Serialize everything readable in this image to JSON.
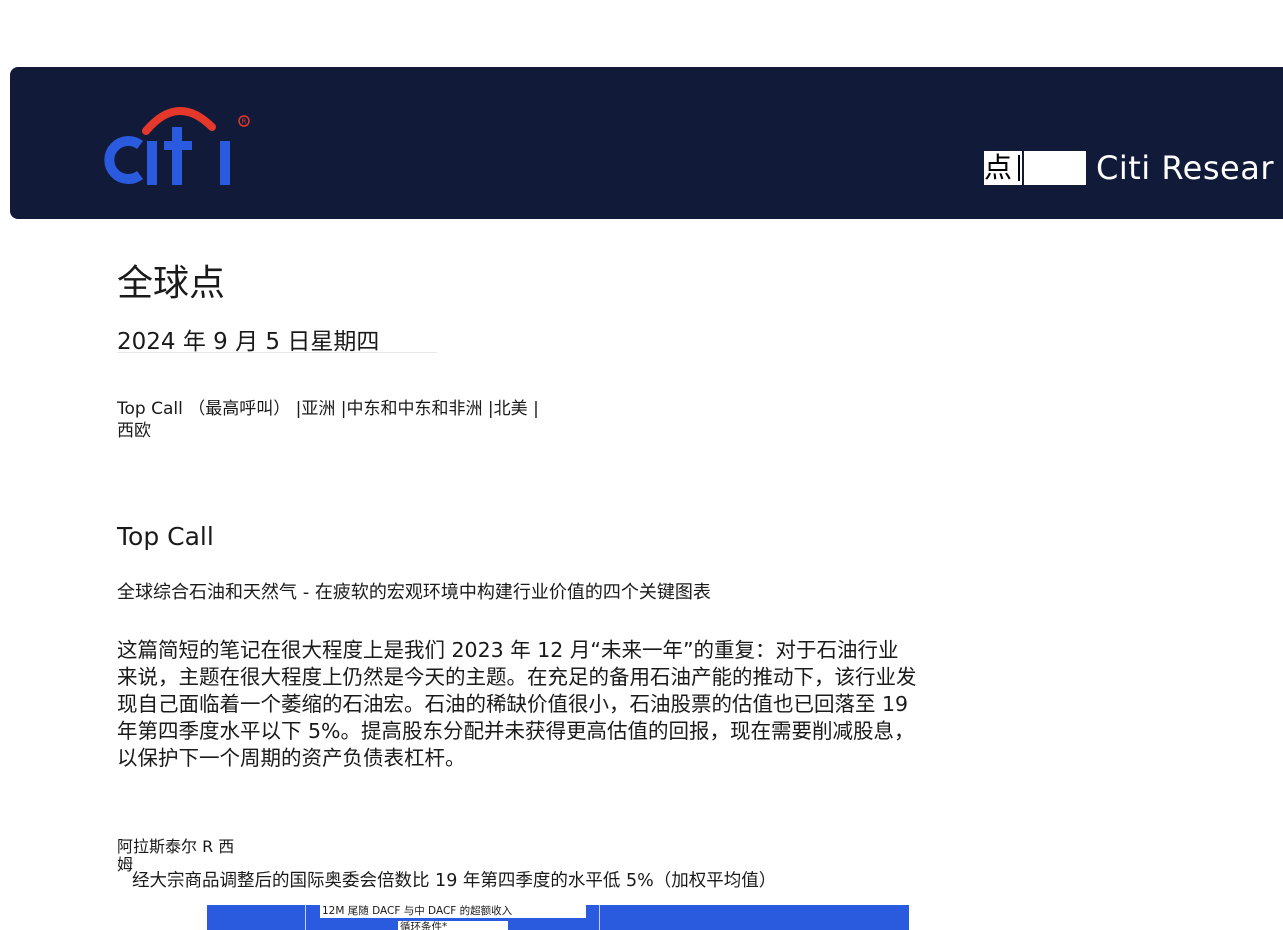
{
  "banner": {
    "logo_text": "citi",
    "right_char": "点",
    "brand_text": "Citi Resear"
  },
  "document": {
    "title": "全球点",
    "date": "2024 年 9 月 5 日星期四",
    "nav": {
      "top_call": "Top Call （最高呼叫）",
      "sep1": "|",
      "asia": "亚洲",
      "sep2": "|",
      "mea": "中东和中东和非洲",
      "sep3": "|",
      "na": "北美",
      "sep4": "|",
      "we": "西欧"
    },
    "section_heading": "Top Call",
    "subheading": "全球综合石油和天然气 - 在疲软的宏观环境中构建行业价值的四个关键图表",
    "paragraph": "这篇简短的笔记在很大程度上是我们 2023 年 12 月“未来一年”的重复：对于石油行业来说，主题在很大程度上仍然是今天的主题。在充足的备用石油产能的推动下，该行业发现自己面临着一个萎缩的石油宏。石油的稀缺价值很小，石油股票的估值也已回落至 19 年第四季度水平以下 5%。提高股东分配并未获得更高估值的回报，现在需要削减股息，以保护下一个周期的资产负债表杠杆。",
    "author": "阿拉斯泰尔 R 西姆",
    "chart_caption": "经大宗商品调整后的国际奥委会倍数比 19 年第四季度的水平低 5%（加权平均值）",
    "chart_label_1": "12M 尾随 DACF 与中 DACF 的超额收入",
    "chart_label_2": "循环条件*"
  },
  "colors": {
    "banner_bg": "#121a3a",
    "logo_blue": "#2a5bde",
    "logo_red": "#e5382b",
    "chart_blue": "#2a5bde"
  }
}
